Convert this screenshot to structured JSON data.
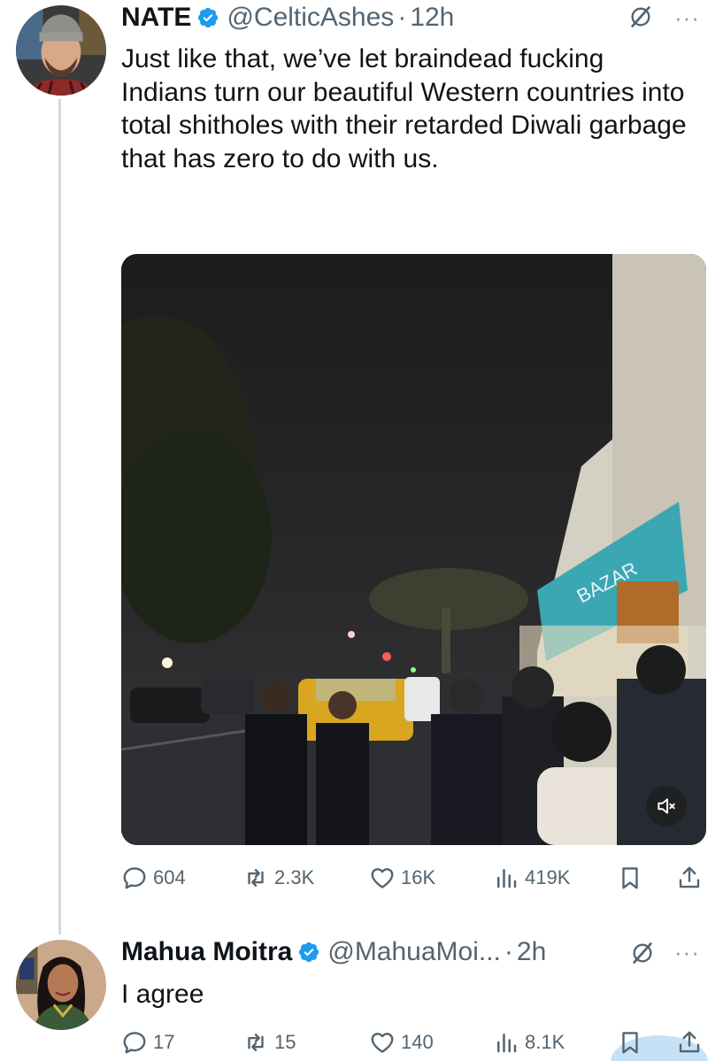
{
  "tweet": {
    "name": "NATE",
    "handle": "@CelticAshes",
    "separator": "·",
    "time": "12h",
    "more": "···",
    "text": "Just like that, we’ve let braindead fucking Indians turn our beautiful Western countries into total shitholes with their retarded Diwali garbage that has zero to do with us.",
    "video": {
      "sign_text": "BAZAR",
      "muted": true
    },
    "actions": {
      "replies": "604",
      "reposts": "2.3K",
      "likes": "16K",
      "views": "419K"
    }
  },
  "reply": {
    "name": "Mahua Moitra",
    "handle": "@MahuaMoi...",
    "separator": "·",
    "time": "2h",
    "more": "···",
    "text": "I agree",
    "actions": {
      "replies": "17",
      "reposts": "15",
      "likes": "140",
      "views": "8.1K"
    }
  },
  "colors": {
    "verified": "#1d9bf0",
    "text": "#0f1419",
    "secondary": "#536471",
    "thread_line": "#cfd9de"
  },
  "icons": [
    "verified-badge-icon",
    "grok-icon",
    "more-icon",
    "reply-icon",
    "repost-icon",
    "like-icon",
    "views-icon",
    "bookmark-icon",
    "share-icon",
    "mute-icon"
  ]
}
